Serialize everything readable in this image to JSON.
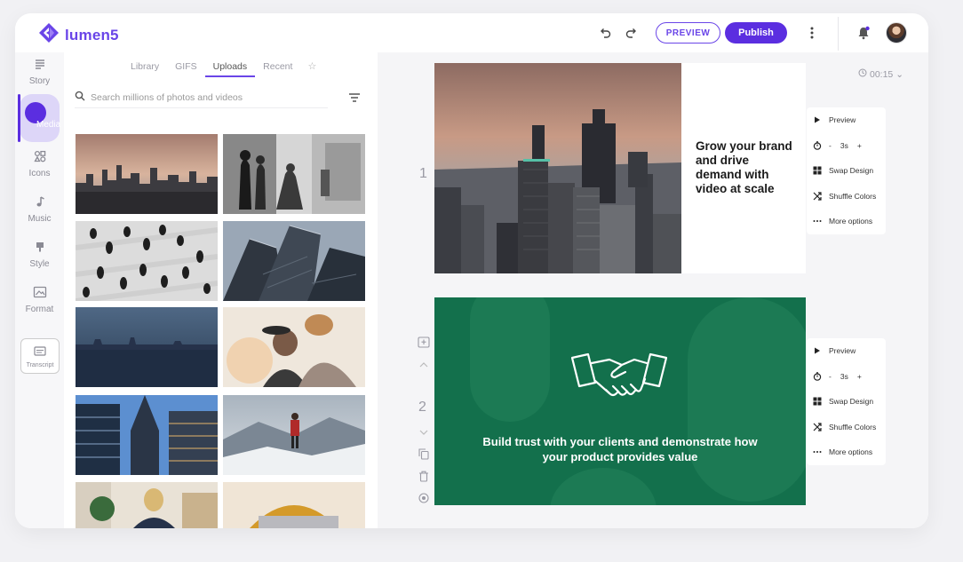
{
  "app": {
    "logo_text": "lumen5"
  },
  "header": {
    "preview_label": "PREVIEW",
    "publish_label": "Publish"
  },
  "nav": {
    "items": [
      {
        "label": "Story"
      },
      {
        "label": "Media"
      },
      {
        "label": "Icons"
      },
      {
        "label": "Music"
      },
      {
        "label": "Style"
      },
      {
        "label": "Format"
      },
      {
        "label": "Transcript"
      }
    ]
  },
  "media_panel": {
    "tabs": [
      "Library",
      "GIFS",
      "Uploads",
      "Recent"
    ],
    "active_tab": "Uploads",
    "search_placeholder": "Search millions of photos and videos"
  },
  "workspace": {
    "timer": "00:15",
    "scenes": [
      {
        "number": "1",
        "text": "Grow your brand and drive demand with video at scale",
        "menu": {
          "preview": "Preview",
          "duration": "3s",
          "swap": "Swap Design",
          "shuffle": "Shuffle Colors",
          "more": "More options"
        }
      },
      {
        "number": "2",
        "text": "Build trust with your clients and demonstrate how your product provides value",
        "menu": {
          "preview": "Preview",
          "duration": "3s",
          "swap": "Swap Design",
          "shuffle": "Shuffle Colors",
          "more": "More options"
        }
      }
    ]
  },
  "colors": {
    "accent": "#5b2ee0",
    "scene2_bg": "#13704c"
  }
}
